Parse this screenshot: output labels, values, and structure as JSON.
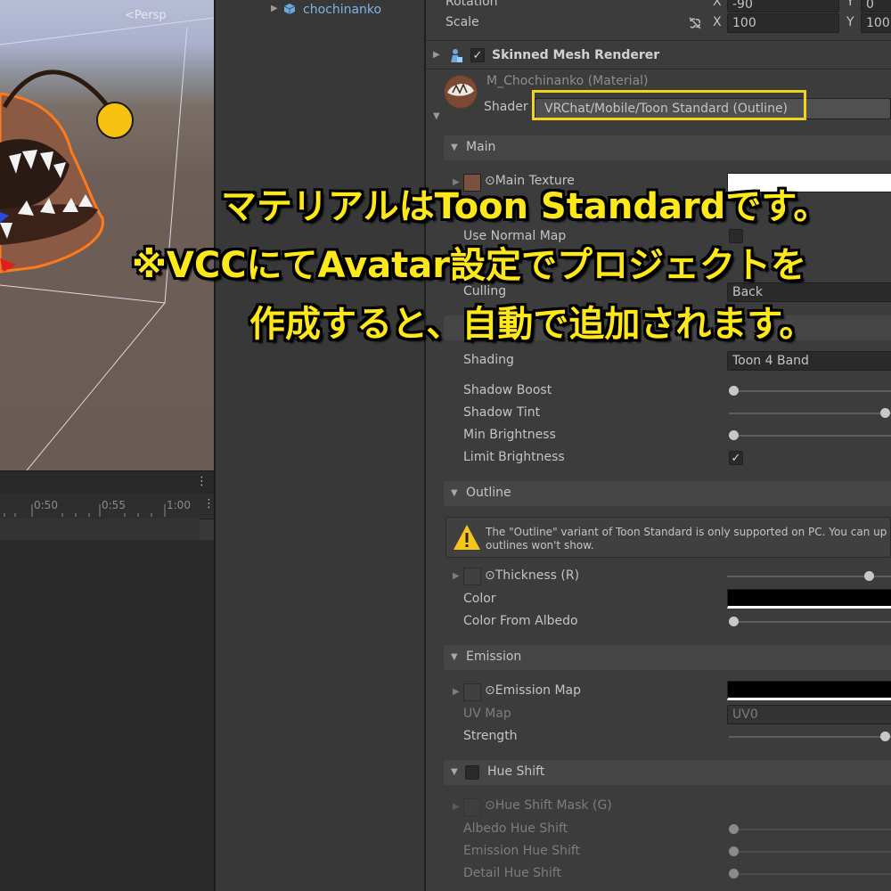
{
  "scene": {
    "back_label": "<Persp"
  },
  "timeline": {
    "ticks": [
      "0:50",
      "0:55",
      "1:00"
    ]
  },
  "hierarchy": {
    "item": "chochinanko"
  },
  "transform": {
    "rotation_label": "Rotation",
    "rotation_x": "-90",
    "rotation_y": "0",
    "scale_label": "Scale",
    "scale_x": "100",
    "scale_y": "100",
    "axis_x": "X",
    "axis_y": "Y"
  },
  "component": {
    "title": "Skinned Mesh Renderer"
  },
  "material": {
    "name": "M_Chochinanko (Material)",
    "shader_label": "Shader",
    "shader_value": "VRChat/Mobile/Toon Standard (Outline)"
  },
  "sections": {
    "main": "Main",
    "outline": "Outline",
    "emission": "Emission",
    "hue_shift": "Hue Shift"
  },
  "main": {
    "main_texture": "⊙Main Texture",
    "use_normal_map": "Use Normal Map",
    "culling_label": "Culling",
    "culling_value": "Back"
  },
  "lighting": {
    "header_partial": "Ligh",
    "shading_label": "Shading",
    "shading_value": "Toon 4 Band",
    "shadow_boost": "Shadow Boost",
    "shadow_tint": "Shadow Tint",
    "min_brightness": "Min Brightness",
    "limit_brightness": "Limit Brightness"
  },
  "outline": {
    "warning": "The \"Outline\" variant of Toon Standard is only supported on PC. You can up",
    "warning_line2": "outlines won't show.",
    "thickness": "⊙Thickness (R)",
    "color": "Color",
    "color_from_albedo": "Color From Albedo"
  },
  "emission": {
    "map": "⊙Emission Map",
    "uv_map_label": "UV Map",
    "uv_map_value": "UV0",
    "strength": "Strength"
  },
  "hue": {
    "mask": "⊙Hue Shift Mask (G)",
    "albedo": "Albedo Hue Shift",
    "emission": "Emission Hue Shift",
    "detail": "Detail Hue Shift"
  },
  "overlay": {
    "line1": "マテリアルはToon Standardです。",
    "line2": "※VCCにてAvatar設定でプロジェクトを",
    "line3": "作成すると、自動で追加されます。"
  },
  "colors": {
    "overlay_text": "#ffe81a",
    "highlight_box": "#f2d31b",
    "link_blue": "#7fb3e6"
  }
}
